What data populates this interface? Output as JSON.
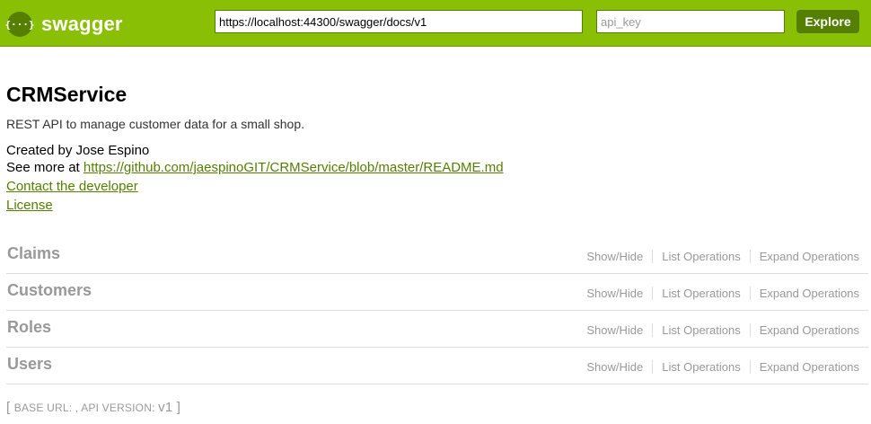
{
  "header": {
    "logo_icon_text": "{···}",
    "logo_text": "swagger",
    "url_value": "https://localhost:44300/swagger/docs/v1",
    "api_key_placeholder": "api_key",
    "explore_label": "Explore",
    "colors": {
      "bar": "#89bf04",
      "dark": "#547f00"
    }
  },
  "info": {
    "title": "CRMService",
    "description": "REST API to manage customer data for a small shop.",
    "created_by": "Created by Jose Espino",
    "see_more_prefix": "See more at ",
    "see_more_link": "https://github.com/jaespinoGIT/CRMService/blob/master/README.md",
    "contact_link": "Contact the developer",
    "license_link": "License"
  },
  "resources": [
    {
      "name": "Claims",
      "show_hide": "Show/Hide",
      "list_ops": "List Operations",
      "expand_ops": "Expand Operations"
    },
    {
      "name": "Customers",
      "show_hide": "Show/Hide",
      "list_ops": "List Operations",
      "expand_ops": "Expand Operations"
    },
    {
      "name": "Roles",
      "show_hide": "Show/Hide",
      "list_ops": "List Operations",
      "expand_ops": "Expand Operations"
    },
    {
      "name": "Users",
      "show_hide": "Show/Hide",
      "list_ops": "List Operations",
      "expand_ops": "Expand Operations"
    }
  ],
  "footer": {
    "open_bracket": "[ ",
    "base_url_label": "Base url: ",
    "separator": ", ",
    "api_version_label": "Api version: ",
    "api_version_value": "v1",
    "close_bracket": " ]"
  }
}
